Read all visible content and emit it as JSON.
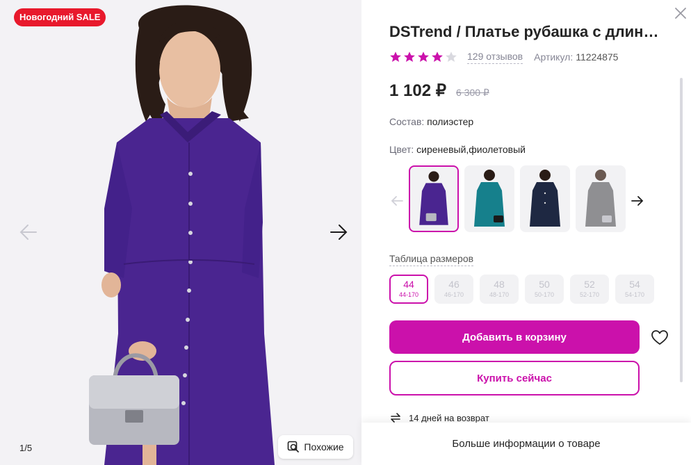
{
  "gallery": {
    "badge": "Новогодний SALE",
    "counter": "1/5",
    "similar_label": "Похожие"
  },
  "product": {
    "title": "DSTrend / Платье рубашка с длинным рукавом",
    "rating": 4,
    "rating_max": 5,
    "reviews": "129 отзывов",
    "article_label": "Артикул:",
    "article_value": "11224875",
    "price": "1 102 ₽",
    "old_price": "6 300 ₽",
    "composition_label": "Состав:",
    "composition_value": "полиэстер",
    "color_label": "Цвет:",
    "color_value": "сиреневый,фиолетовый",
    "size_table_label": "Таблица размеров",
    "sizes": [
      {
        "n": "44",
        "s": "44-170",
        "selected": true
      },
      {
        "n": "46",
        "s": "46-170",
        "selected": false
      },
      {
        "n": "48",
        "s": "48-170",
        "selected": false
      },
      {
        "n": "50",
        "s": "50-170",
        "selected": false
      },
      {
        "n": "52",
        "s": "52-170",
        "selected": false
      },
      {
        "n": "54",
        "s": "54-170",
        "selected": false
      }
    ],
    "add_to_cart": "Добавить в корзину",
    "buy_now": "Купить сейчас",
    "return_info": "14 дней на возврат",
    "more_info": "Больше информации о товаре"
  },
  "colors": {
    "accent": "#cb11ab",
    "sale": "#e8192c",
    "dress_purple": "#4a2590",
    "variant_teal": "#16808c",
    "variant_navy": "#1e2842",
    "variant_gray": "#3e3e42"
  },
  "icons": [
    "close-icon",
    "arrow-left-icon",
    "arrow-right-icon",
    "heart-icon",
    "return-icon",
    "search-image-icon",
    "star-icon"
  ]
}
